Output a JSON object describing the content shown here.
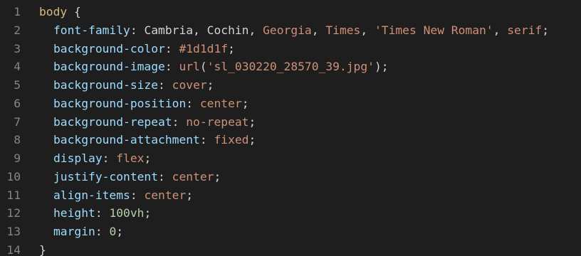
{
  "colors": {
    "background": "#1e1e1e",
    "line_number": "#858585",
    "selector": "#d7ba7d",
    "punctuation": "#d4d4d4",
    "property": "#9cdcfe",
    "string_value": "#ce9178",
    "number_value": "#b5cea8"
  },
  "lines": [
    {
      "n": "1",
      "selector": "body",
      "brace": " {"
    },
    {
      "n": "2",
      "prop": "font-family",
      "sep": ": ",
      "tokens": [
        {
          "t": "Cambria",
          "c": "punc"
        },
        {
          "t": ", ",
          "c": "punc"
        },
        {
          "t": "Cochin",
          "c": "punc"
        },
        {
          "t": ", ",
          "c": "punc"
        },
        {
          "t": "Georgia",
          "c": "val"
        },
        {
          "t": ", ",
          "c": "punc"
        },
        {
          "t": "Times",
          "c": "val"
        },
        {
          "t": ", ",
          "c": "punc"
        },
        {
          "t": "'Times New Roman'",
          "c": "val"
        },
        {
          "t": ", ",
          "c": "punc"
        },
        {
          "t": "serif",
          "c": "val"
        },
        {
          "t": ";",
          "c": "punc"
        }
      ]
    },
    {
      "n": "3",
      "prop": "background-color",
      "sep": ": ",
      "tokens": [
        {
          "t": "#1d1d1f",
          "c": "val"
        },
        {
          "t": ";",
          "c": "punc"
        }
      ]
    },
    {
      "n": "4",
      "prop": "background-image",
      "sep": ": ",
      "tokens": [
        {
          "t": "url",
          "c": "val"
        },
        {
          "t": "(",
          "c": "punc"
        },
        {
          "t": "'sl_030220_28570_39.jpg'",
          "c": "val"
        },
        {
          "t": ");",
          "c": "punc"
        }
      ]
    },
    {
      "n": "5",
      "prop": "background-size",
      "sep": ": ",
      "tokens": [
        {
          "t": "cover",
          "c": "val"
        },
        {
          "t": ";",
          "c": "punc"
        }
      ]
    },
    {
      "n": "6",
      "prop": "background-position",
      "sep": ": ",
      "tokens": [
        {
          "t": "center",
          "c": "val"
        },
        {
          "t": ";",
          "c": "punc"
        }
      ]
    },
    {
      "n": "7",
      "prop": "background-repeat",
      "sep": ": ",
      "tokens": [
        {
          "t": "no-repeat",
          "c": "val"
        },
        {
          "t": ";",
          "c": "punc"
        }
      ]
    },
    {
      "n": "8",
      "prop": "background-attachment",
      "sep": ": ",
      "tokens": [
        {
          "t": "fixed",
          "c": "val"
        },
        {
          "t": ";",
          "c": "punc"
        }
      ]
    },
    {
      "n": "9",
      "prop": "display",
      "sep": ": ",
      "tokens": [
        {
          "t": "flex",
          "c": "val"
        },
        {
          "t": ";",
          "c": "punc"
        }
      ]
    },
    {
      "n": "10",
      "prop": "justify-content",
      "sep": ": ",
      "tokens": [
        {
          "t": "center",
          "c": "val"
        },
        {
          "t": ";",
          "c": "punc"
        }
      ]
    },
    {
      "n": "11",
      "prop": "align-items",
      "sep": ": ",
      "tokens": [
        {
          "t": "center",
          "c": "val"
        },
        {
          "t": ";",
          "c": "punc"
        }
      ]
    },
    {
      "n": "12",
      "prop": "height",
      "sep": ": ",
      "tokens": [
        {
          "t": "100vh",
          "c": "num"
        },
        {
          "t": ";",
          "c": "punc"
        }
      ]
    },
    {
      "n": "13",
      "prop": "margin",
      "sep": ": ",
      "tokens": [
        {
          "t": "0",
          "c": "num"
        },
        {
          "t": ";",
          "c": "punc"
        }
      ]
    },
    {
      "n": "14",
      "brace": "}"
    }
  ]
}
